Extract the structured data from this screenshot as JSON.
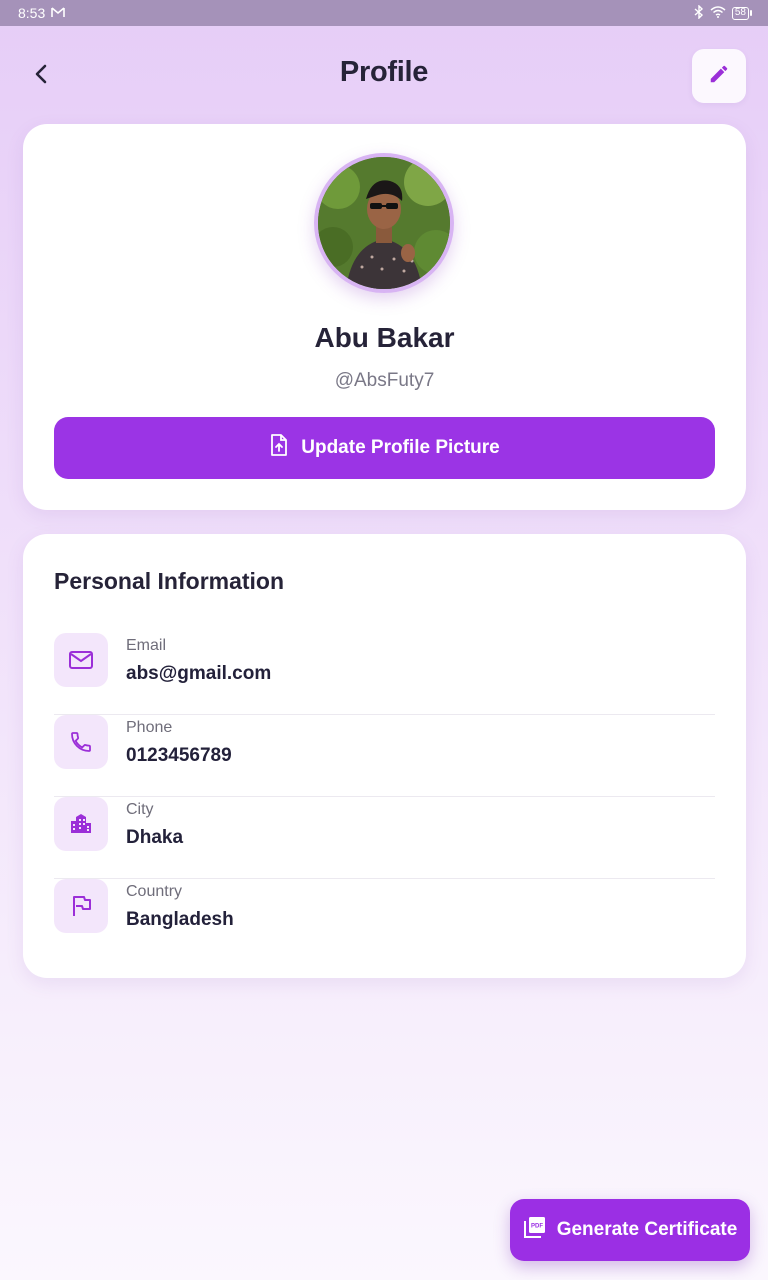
{
  "status_bar": {
    "time": "8:53",
    "battery": "58",
    "icons": [
      "gmail-icon",
      "bluetooth-icon",
      "wifi-icon",
      "battery-icon"
    ]
  },
  "header": {
    "title": "Profile",
    "back_icon": "back-arrow-icon",
    "edit_icon": "pencil-icon"
  },
  "profile": {
    "name": "Abu Bakar",
    "handle": "@AbsFuty7",
    "update_button_label": "Update Profile Picture",
    "update_button_icon": "file-upload-icon"
  },
  "personal_info": {
    "title": "Personal Information",
    "items": [
      {
        "label": "Email",
        "value": "abs@gmail.com",
        "icon": "mail-icon"
      },
      {
        "label": "Phone",
        "value": "0123456789",
        "icon": "phone-icon"
      },
      {
        "label": "City",
        "value": "Dhaka",
        "icon": "city-icon"
      },
      {
        "label": "Country",
        "value": "Bangladesh",
        "icon": "flag-icon"
      }
    ]
  },
  "fab": {
    "label": "Generate Certificate",
    "icon": "pdf-icon"
  },
  "colors": {
    "accent": "#9b34e5",
    "icon_tint": "#9b2fd8",
    "icon_bg": "#f3e6fb",
    "text_dark": "#262338",
    "text_muted": "#6f6d7a"
  }
}
